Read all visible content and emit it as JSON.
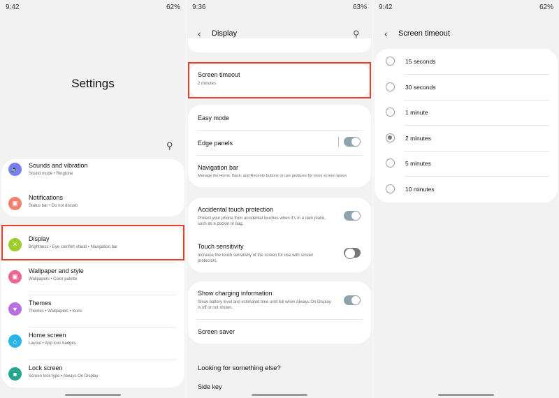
{
  "panel1": {
    "status": {
      "time": "9:42",
      "battery": "62%"
    },
    "title": "Settings",
    "items": [
      {
        "label": "Sounds and vibration",
        "sub": "Sound mode • Ringtone",
        "icon": "speaker-icon",
        "color": "#7b7ef0"
      },
      {
        "label": "Notifications",
        "sub": "Status bar • Do not disturb",
        "icon": "notification-icon",
        "color": "#f0806c"
      },
      {
        "label": "Display",
        "sub": "Brightness • Eye comfort shield • Navigation bar",
        "icon": "sun-icon",
        "color": "#9acd2a"
      },
      {
        "label": "Wallpaper and style",
        "sub": "Wallpapers • Color palette",
        "icon": "image-icon",
        "color": "#ec6592"
      },
      {
        "label": "Themes",
        "sub": "Themes • Wallpapers • Icons",
        "icon": "brush-icon",
        "color": "#b76fe0"
      },
      {
        "label": "Home screen",
        "sub": "Layout • App icon badges",
        "icon": "home-icon",
        "color": "#28b4e8"
      },
      {
        "label": "Lock screen",
        "sub": "Screen lock type • Always On Display",
        "icon": "lock-icon",
        "color": "#25a58e"
      }
    ]
  },
  "panel2": {
    "status": {
      "time": "9:36",
      "battery": "63%"
    },
    "title": "Display",
    "screen_timeout": {
      "label": "Screen timeout",
      "sub": "2 minutes"
    },
    "easy_mode": "Easy mode",
    "edge_panels": {
      "label": "Edge panels",
      "on": true
    },
    "navigation_bar": {
      "label": "Navigation bar",
      "sub": "Manage the Home, Back, and Recents buttons or use gestures for more screen space"
    },
    "accidental": {
      "label": "Accidental touch protection",
      "sub1": "Protect your phone from accidental touches when it's in a dark place,",
      "sub2": "such as a pocket or bag.",
      "on": true
    },
    "touch": {
      "label": "Touch sensitivity",
      "sub1": "Increase the touch sensitivity of the screen for use with screen",
      "sub2": "protectors.",
      "on": false
    },
    "charging": {
      "label": "Show charging information",
      "sub1": "Show battery level and estimated time until full when Always On Display",
      "sub2": "is off or not shown.",
      "on": true
    },
    "screen_saver": "Screen saver",
    "looking": "Looking for something else?",
    "side_key": "Side key"
  },
  "panel3": {
    "status": {
      "time": "9:42",
      "battery": "62%"
    },
    "title": "Screen timeout",
    "options": [
      "15 seconds",
      "30 seconds",
      "1 minute",
      "2 minutes",
      "5 minutes",
      "10 minutes"
    ],
    "selected": "2 minutes"
  },
  "colors": {
    "highlight": "#e4402b",
    "toggle_on": "#8fa3ae"
  }
}
